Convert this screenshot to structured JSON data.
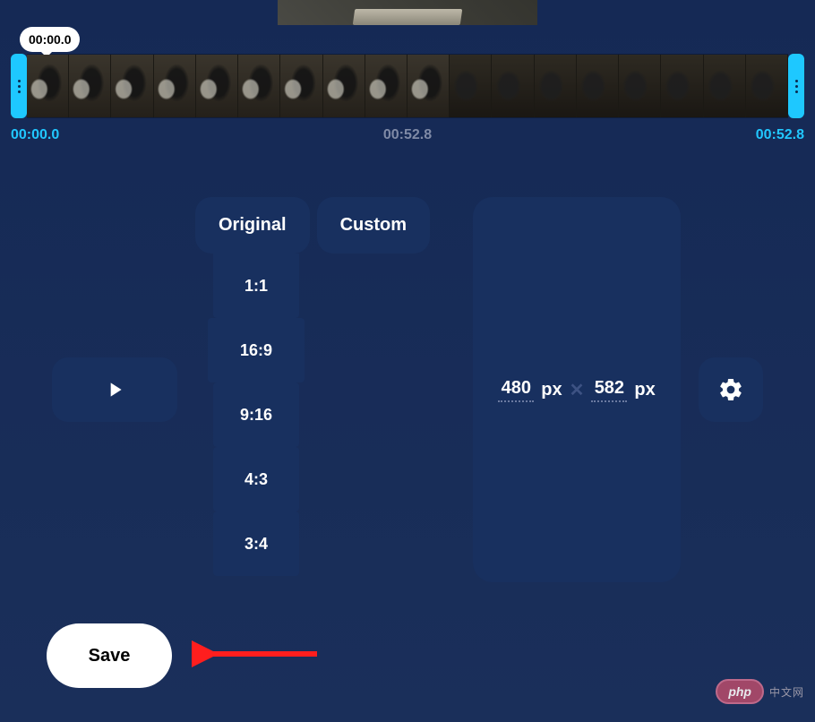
{
  "preview": {},
  "timeline": {
    "bubble": "00:00.0",
    "start": "00:00.0",
    "mid": "00:52.8",
    "end": "00:52.8",
    "frame_count": 18
  },
  "tabs": {
    "original": "Original",
    "custom": "Custom"
  },
  "ratios": [
    "1:1",
    "16:9",
    "9:16",
    "4:3",
    "3:4"
  ],
  "dimensions": {
    "width": "480",
    "width_unit": "px",
    "height": "582",
    "height_unit": "px",
    "sep": "✕"
  },
  "save_label": "Save",
  "badge": {
    "logo": "php",
    "cn": "中文网"
  },
  "colors": {
    "accent": "#1ec8ff",
    "panel": "#18305f",
    "bg_top": "#152955"
  }
}
